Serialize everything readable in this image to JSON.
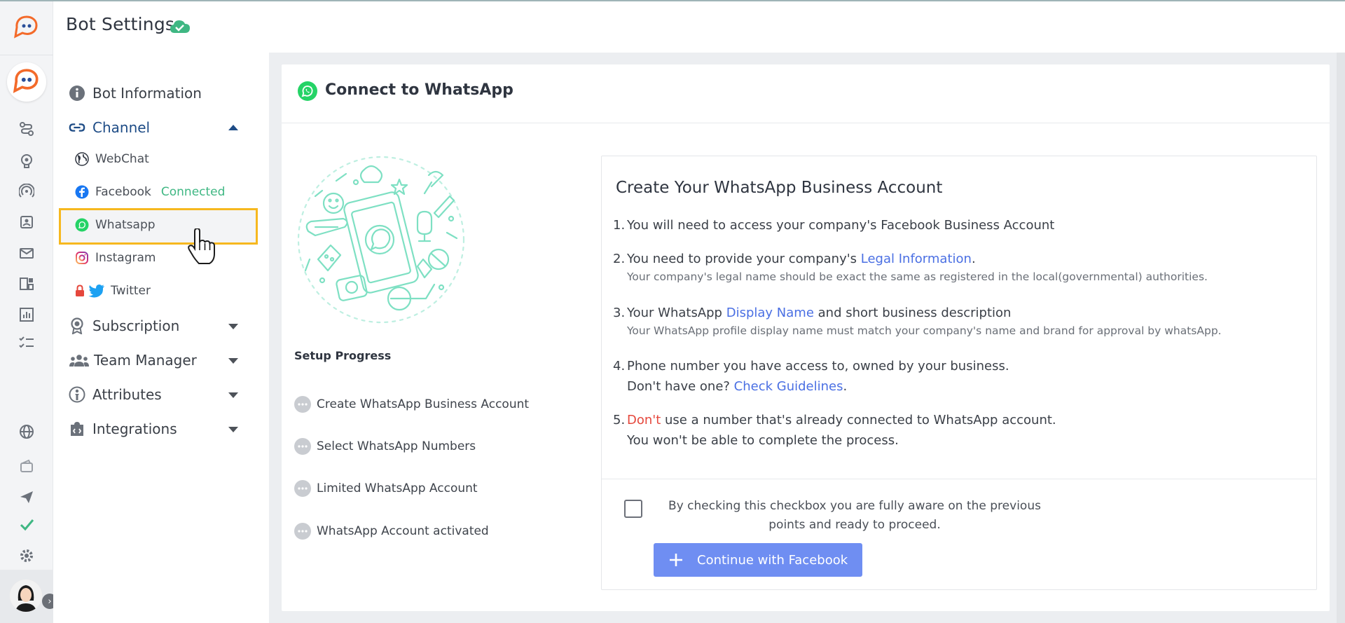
{
  "header": {
    "title": "Bot Settings"
  },
  "nav": {
    "items": [
      {
        "label": "Bot Information"
      },
      {
        "label": "Channel"
      },
      {
        "label": "Subscription"
      },
      {
        "label": "Team Manager"
      },
      {
        "label": "Attributes"
      },
      {
        "label": "Integrations"
      }
    ],
    "channels": [
      {
        "label": "WebChat"
      },
      {
        "label": "Facebook",
        "status": "Connected"
      },
      {
        "label": "Whatsapp"
      },
      {
        "label": "Instagram"
      },
      {
        "label": "Twitter"
      }
    ]
  },
  "main": {
    "title": "Connect to WhatsApp",
    "progress_title": "Setup Progress",
    "steps": [
      "Create WhatsApp Business Account",
      "Select WhatsApp Numbers",
      "Limited WhatsApp Account",
      "WhatsApp Account activated"
    ],
    "info": {
      "heading": "Create Your WhatsApp Business Account",
      "p1": {
        "num": "1.",
        "text": "You will need to access your company's Facebook Business Account"
      },
      "p2": {
        "num": "2.",
        "pre": "You need to provide your company's ",
        "link": "Legal Information",
        "post": ".",
        "sub": "Your company's legal name should be exact the same as registered in the local(governmental) authorities."
      },
      "p3": {
        "num": "3.",
        "pre": "Your WhatsApp ",
        "link": "Display Name",
        "post": " and short business description",
        "sub": "Your WhatsApp profile display name must match your company's name and brand for approval by whatsApp."
      },
      "p4": {
        "num": "4.",
        "text": "Phone number you have access to, owned by your business.",
        "line2_pre": "Don't have one? ",
        "line2_link": "Check Guidelines",
        "line2_post": "."
      },
      "p5": {
        "num": "5.",
        "red": "Don't",
        "text": " use a number that's already connected to WhatsApp account.",
        "line2": "You won't be able to complete the process."
      },
      "checkbox_text": "By checking this checkbox you are fully aware on the previous points and ready to proceed.",
      "button_label": "Continue with Facebook"
    }
  },
  "colors": {
    "accent": "#1e4c86",
    "link": "#4a6fe3",
    "success": "#3fb783",
    "button": "#6f8ef2",
    "highlight": "#f6b81f",
    "illustration": "#7ee0c3"
  }
}
